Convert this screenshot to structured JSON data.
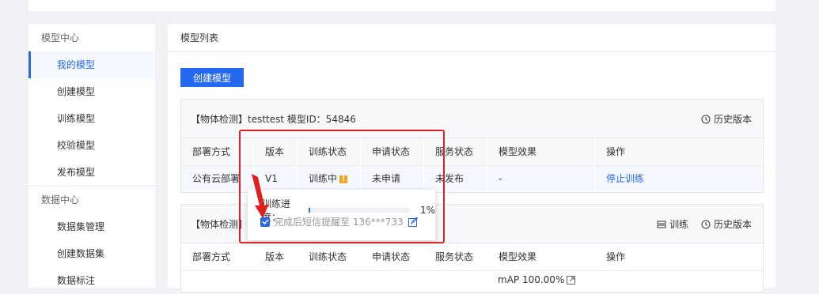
{
  "sidebar": {
    "section1": "模型中心",
    "items1": [
      "我的模型",
      "创建模型",
      "训练模型",
      "校验模型",
      "发布模型"
    ],
    "section2": "数据中心",
    "items2": [
      "数据集管理",
      "创建数据集",
      "数据标注"
    ]
  },
  "main": {
    "title": "模型列表",
    "create_button": "创建模型"
  },
  "columns": [
    "部署方式",
    "版本",
    "训练状态",
    "申请状态",
    "服务状态",
    "模型效果",
    "操作"
  ],
  "card1": {
    "title": "【物体检测】testtest 模型ID：54846",
    "history": "历史版本",
    "row": {
      "deploy": "公有云部署",
      "version": "V1",
      "train_status": "训练中",
      "apply_status": "未申请",
      "service_status": "未发布",
      "effect": "-",
      "action": "停止训练"
    }
  },
  "card2": {
    "title": "【物体检测】",
    "train": "训练",
    "history": "历史版本",
    "map": "mAP 100.00%"
  },
  "popover": {
    "progress_label": "训练进度：",
    "progress_value": 0.01,
    "progress_text": "1%",
    "sms_text": "完成后短信提醒至 136***733",
    "sms_checked": true
  },
  "colors": {
    "accent": "#2468f2",
    "annotation": "#e02020",
    "warning": "#f5a623"
  }
}
